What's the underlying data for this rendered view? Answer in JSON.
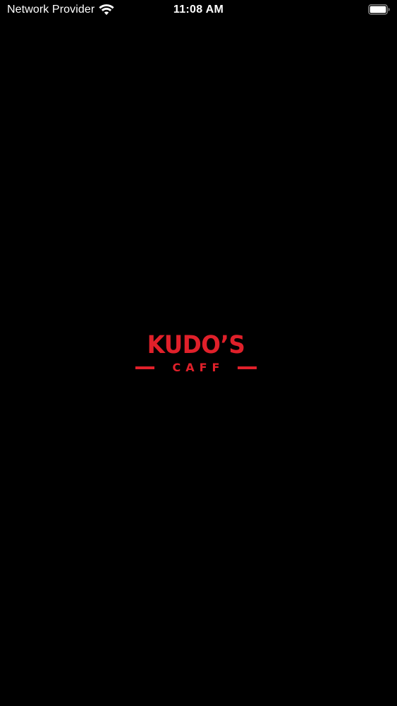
{
  "status_bar": {
    "carrier": "Network Provider",
    "time": "11:08 AM",
    "wifi_icon": "wifi-icon",
    "battery_icon": "battery-icon",
    "battery_level": 1.0
  },
  "splash": {
    "logo_title": "KUDO’S",
    "logo_subtitle": "CAFF",
    "logo_color": "#e0202a",
    "background": "#000000"
  }
}
